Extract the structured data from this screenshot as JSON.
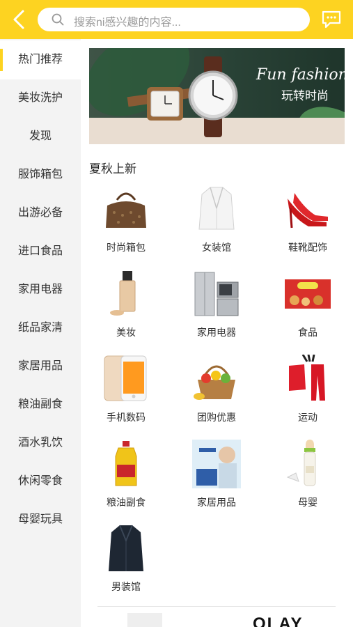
{
  "colors": {
    "accent": "#fdd321",
    "sidebar_bg": "#f3f3f3"
  },
  "header": {
    "back_icon": "chevron-left-icon",
    "search_placeholder": "搜索ni感兴趣的内容...",
    "message_icon": "chat-bubble-icon"
  },
  "sidebar": {
    "items": [
      {
        "label": "热门推荐",
        "active": true
      },
      {
        "label": "美妆洗护"
      },
      {
        "label": "发现"
      },
      {
        "label": "服饰箱包"
      },
      {
        "label": "出游必备"
      },
      {
        "label": "进口食品"
      },
      {
        "label": "家用电器"
      },
      {
        "label": "纸品家清"
      },
      {
        "label": "家居用品"
      },
      {
        "label": "粮油副食"
      },
      {
        "label": "酒水乳饮"
      },
      {
        "label": "休闲零食"
      },
      {
        "label": "母婴玩具"
      }
    ]
  },
  "banner": {
    "title": "Fun fashion",
    "subtitle": "玩转时尚"
  },
  "section": {
    "title": "夏秋上新"
  },
  "categories": [
    {
      "label": "时尚箱包",
      "icon": "handbag-icon"
    },
    {
      "label": "女装馆",
      "icon": "blazer-icon"
    },
    {
      "label": "鞋靴配饰",
      "icon": "high-heels-icon"
    },
    {
      "label": "美妆",
      "icon": "foundation-bottle-icon"
    },
    {
      "label": "家用电器",
      "icon": "appliances-icon"
    },
    {
      "label": "食品",
      "icon": "snack-box-icon"
    },
    {
      "label": "手机数码",
      "icon": "smartphone-icon"
    },
    {
      "label": "团购优惠",
      "icon": "fruit-basket-icon"
    },
    {
      "label": "运动",
      "icon": "sportswear-icon"
    },
    {
      "label": "粮油副食",
      "icon": "cooking-oil-icon"
    },
    {
      "label": "家居用品",
      "icon": "tissue-pack-icon"
    },
    {
      "label": "母婴",
      "icon": "baby-bottle-icon"
    },
    {
      "label": "男装馆",
      "icon": "coat-icon"
    }
  ],
  "footer_brand": "OLAY"
}
